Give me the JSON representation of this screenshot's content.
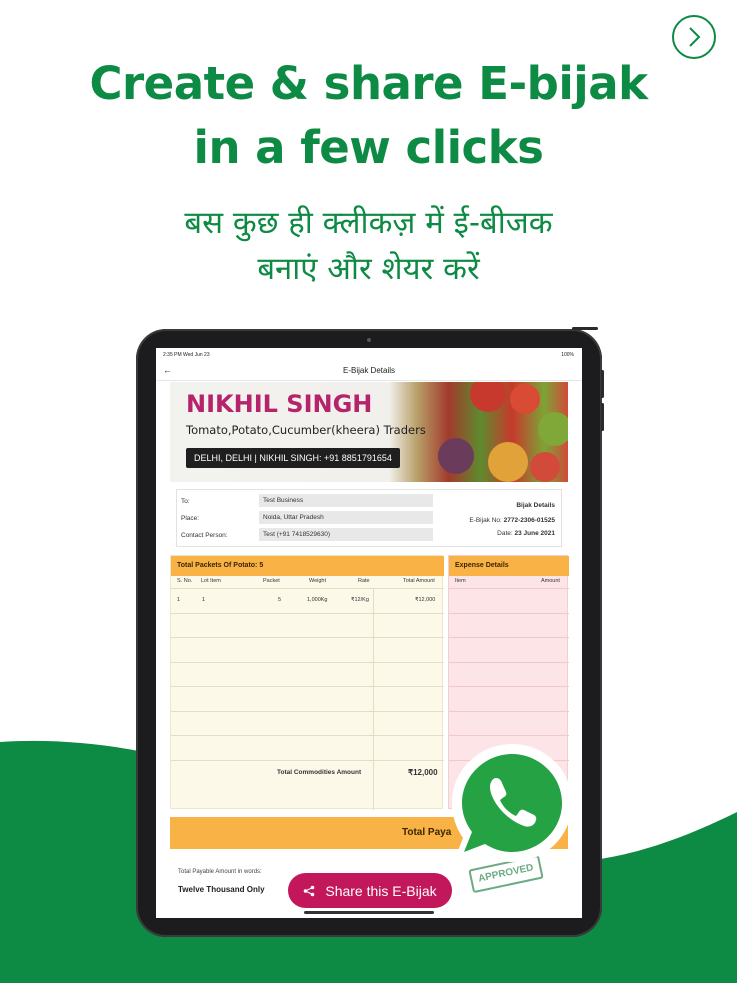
{
  "colors": {
    "brand_green": "#0d8a43",
    "accent_orange": "#f9b246",
    "share_pink": "#c2185b",
    "shop_name_magenta": "#b5246a",
    "whatsapp_green": "#25a244"
  },
  "nav": {
    "next_icon": "chevron-right-icon"
  },
  "headline": {
    "line1": "Create & share E-bijak",
    "line2": "in a few clicks"
  },
  "subhead": {
    "line1": "बस कुछ ही क्लीकज़ में ई-बीजक",
    "line2": "बनाएं और शेयर करें"
  },
  "device": {
    "status": {
      "time": "2:35 PM  Wed Jun 23",
      "battery": "100%"
    },
    "appbar": {
      "title": "E-Bijak Details",
      "back_icon": "arrow-left-icon"
    }
  },
  "bill": {
    "shop": {
      "name": "NIKHIL SINGH",
      "items": "Tomato,Potato,Cucumber(kheera) Traders",
      "contact": "DELHI, DELHI   |   NIKHIL SINGH: +91 8851791654"
    },
    "party": {
      "to_label": "To:",
      "to_value": "Test Business",
      "place_label": "Place:",
      "place_value": "Noida, Uttar Pradesh",
      "contact_label": "Contact Person:",
      "contact_value": "Test (+91 7418529630)"
    },
    "details": {
      "title": "Bijak Details",
      "no_label": "E-Bijak No:",
      "no_value": "2772-2306-01525",
      "date_label": "Date:",
      "date_value": "23 June 2021"
    },
    "goods": {
      "header": "Total Packets Of Potato: 5",
      "columns": [
        "S. No.",
        "Lot Item",
        "Packet",
        "Weight",
        "Rate",
        "Total Amount"
      ],
      "rows": [
        {
          "sno": "1",
          "lot": "1",
          "packet": "5",
          "weight": "1,000Kg",
          "rate": "₹12/Kg",
          "amount": "₹12,000"
        }
      ],
      "total_label": "Total Commodities Amount",
      "total_value": "₹12,000"
    },
    "expense": {
      "header": "Expense Details",
      "columns": [
        "Item",
        "Amount"
      ]
    },
    "payable": {
      "label": "Total Paya"
    },
    "words": {
      "label": "Total Payable Amount in words:",
      "value": "Twelve Thousand Only"
    },
    "stamp": "APPROVED"
  },
  "share": {
    "label": "Share this E-Bijak",
    "icon": "share-icon"
  },
  "overlay": {
    "icon": "whatsapp-icon"
  }
}
